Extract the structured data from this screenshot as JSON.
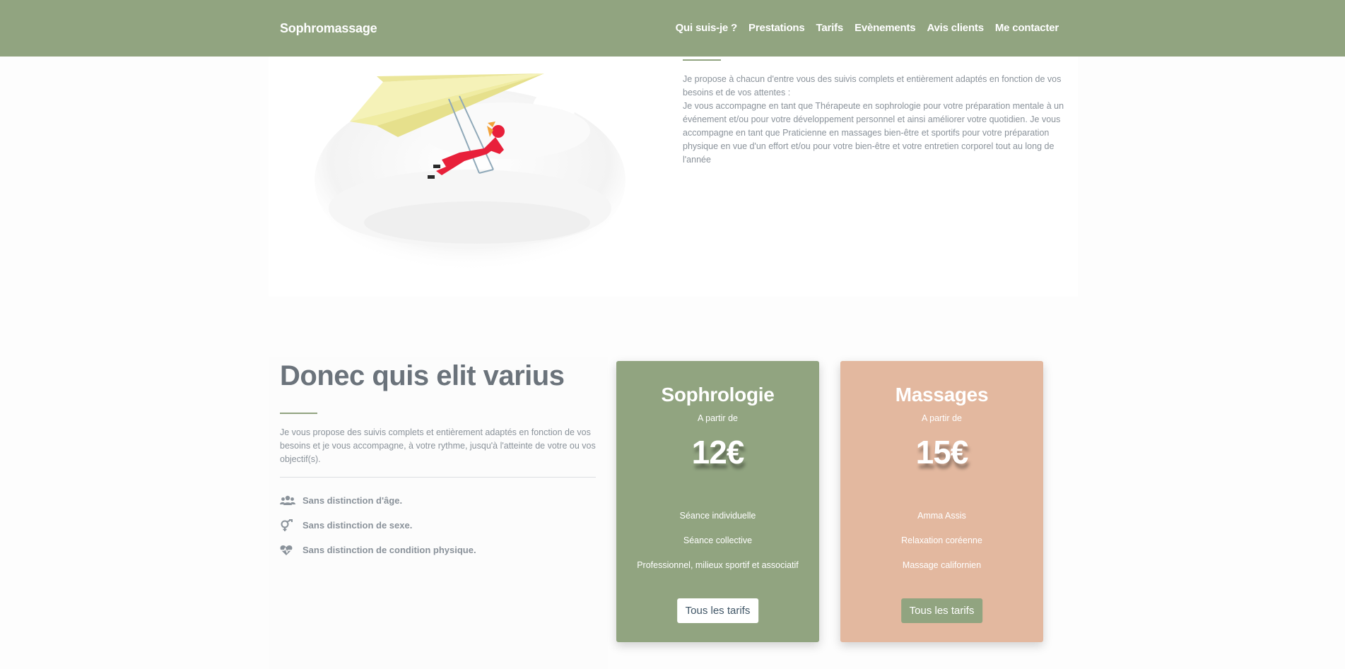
{
  "navbar": {
    "brand": "Sophromassage",
    "links": [
      "Qui suis-je ?",
      "Prestations",
      "Tarifs",
      "Evènements",
      "Avis clients",
      "Me contacter"
    ]
  },
  "about": {
    "paragraphs": [
      "Je propose à chacun d'entre vous des suivis complets et entièrement adaptés en fonction de vos besoins et de vos attentes :",
      "Je vous accompagne en tant que Thérapeute en sophrologie pour votre préparation mentale à un événement et/ou pour votre développement personnel et ainsi améliorer votre quotidien. Je vous accompagne en tant que Praticienne en massages bien-être et sportifs pour votre préparation physique en vue d'un effort et/ou pour votre bien-être et votre entretien corporel tout au long de l'année"
    ]
  },
  "info": {
    "title": "Donec quis elit varius",
    "text": "Je vous propose des suivis complets et entièrement adaptés en fonction de vos besoins et je vous accompagne, à votre rythme, jusqu'à l'atteinte de votre ou vos objectif(s).",
    "features": [
      {
        "icon": "users-icon",
        "label": "Sans distinction d'âge."
      },
      {
        "icon": "gender-icon",
        "label": "Sans distinction de sexe."
      },
      {
        "icon": "heartbeat-icon",
        "label": "Sans distinction de condition physique."
      }
    ]
  },
  "cards": [
    {
      "title": "Sophrologie",
      "from": "A partir de",
      "price": "12€",
      "items": [
        "Séance individuelle",
        "Séance collective",
        "Professionnel, milieux sportif et associatif"
      ],
      "button": "Tous les tarifs",
      "color": "#91a480"
    },
    {
      "title": "Massages",
      "from": "A partir de",
      "price": "15€",
      "items": [
        "Amma Assis",
        "Relaxation coréenne",
        "Massage californien"
      ],
      "button": "Tous les tarifs",
      "color": "#e3b89f"
    }
  ],
  "colors": {
    "brand": "#91a480",
    "accent": "#e3b89f",
    "text": "#8a929a",
    "heading": "#6b737b"
  }
}
